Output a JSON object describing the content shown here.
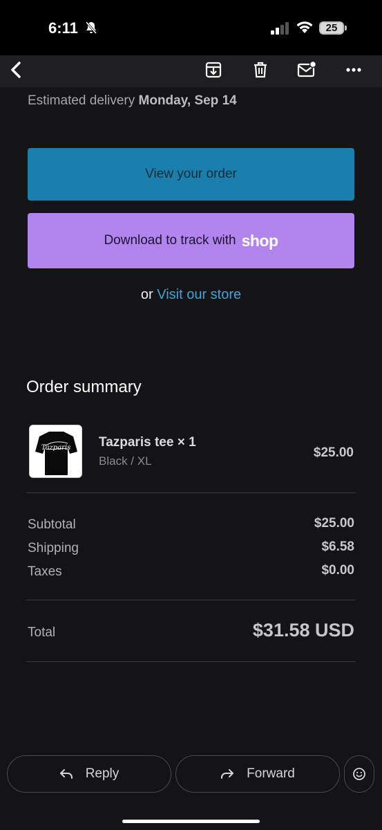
{
  "status": {
    "time": "6:11",
    "battery": "25"
  },
  "toolbar": {
    "back": "back-chevron-icon",
    "archive": "archive-icon",
    "delete": "trash-icon",
    "mark_unread": "mail-unread-icon",
    "more": "more-icon"
  },
  "delivery": {
    "label": "Estimated delivery",
    "date": "Monday, Sep 14"
  },
  "buttons": {
    "view_order": "View your order",
    "download_track": "Download to track with",
    "shop_logo": "shop"
  },
  "visit": {
    "prefix": "or",
    "link": "Visit our store"
  },
  "summary": {
    "title": "Order summary",
    "item": {
      "name": "Tazparis tee × 1",
      "variant": "Black / XL",
      "price": "$25.00",
      "thumb_text": "Tazparis"
    },
    "subtotal": {
      "label": "Subtotal",
      "value": "$25.00"
    },
    "shipping": {
      "label": "Shipping",
      "value": "$6.58"
    },
    "taxes": {
      "label": "Taxes",
      "value": "$0.00"
    },
    "total": {
      "label": "Total",
      "value": "$31.58 USD"
    }
  },
  "footer": {
    "reply": "Reply",
    "forward": "Forward",
    "emoji": "emoji-icon"
  },
  "colors": {
    "view_button": "#1a7fad",
    "shop_button": "#b184ee",
    "link": "#3ea6d6",
    "background": "#141416"
  }
}
